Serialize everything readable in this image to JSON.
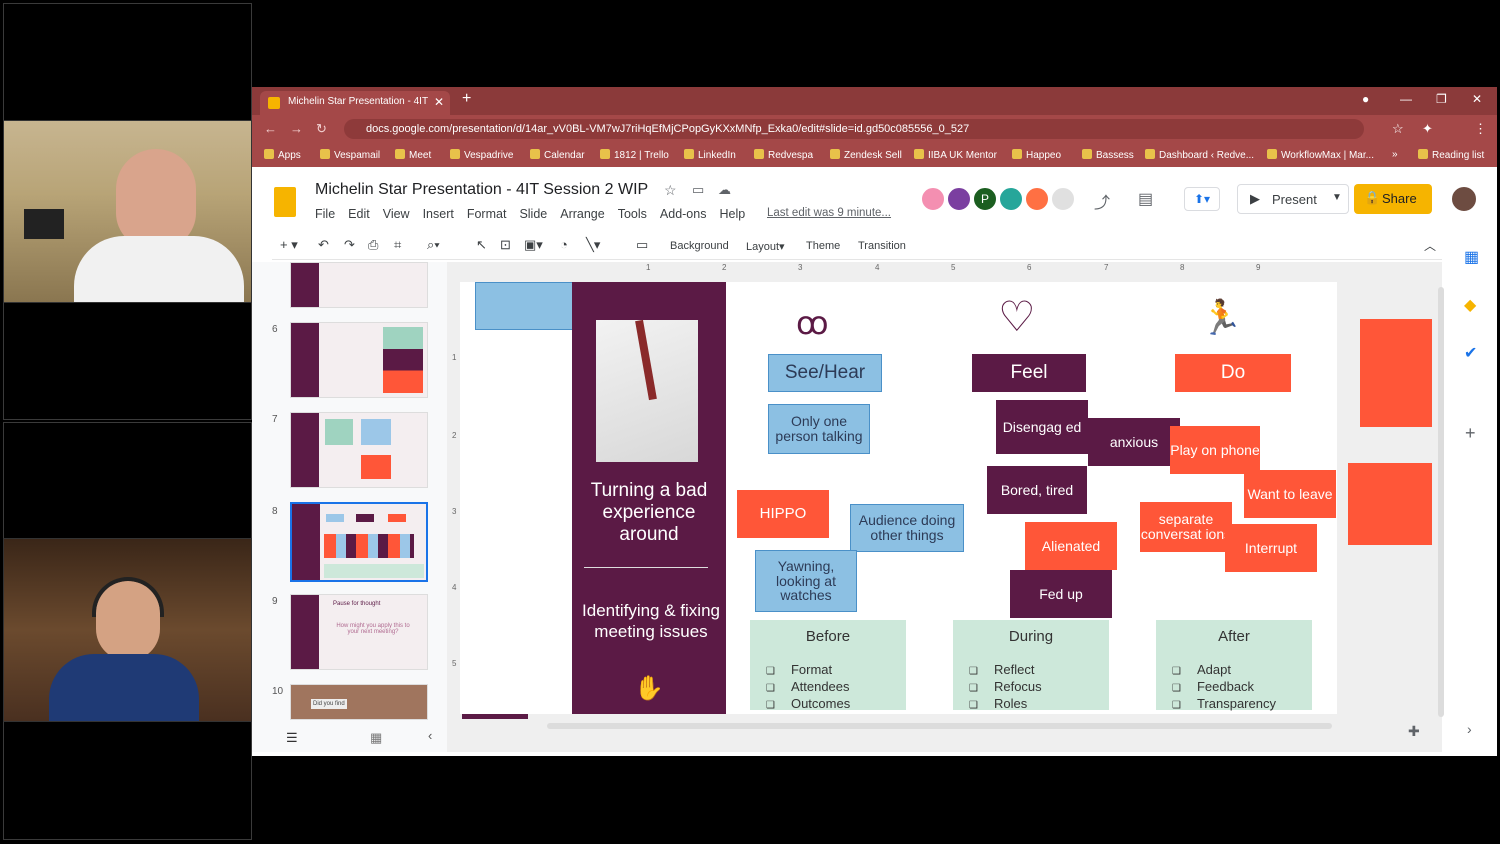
{
  "browser": {
    "tab_title": "Michelin Star Presentation - 4IT",
    "url": "docs.google.com/presentation/d/14ar_vV0BL-VM7wJ7riHqEfMjCPopGyKXxMNfp_Exka0/edit#slide=id.gd50c085556_0_527",
    "bookmarks": [
      "Apps",
      "Vespamail",
      "Meet",
      "Vespadrive",
      "Calendar",
      "1812 | Trello",
      "LinkedIn",
      "Redvespa",
      "Zendesk Sell",
      "IIBA UK Mentor",
      "Happeo",
      "Bassess",
      "Dashboard ‹ Redve...",
      "WorkflowMax | Mar...",
      "»",
      "Reading list"
    ]
  },
  "docs": {
    "title": "Michelin Star Presentation - 4IT Session 2 WIP",
    "menu": [
      "File",
      "Edit",
      "View",
      "Insert",
      "Format",
      "Slide",
      "Arrange",
      "Tools",
      "Add-ons",
      "Help"
    ],
    "last_edit": "Last edit was 9 minute...",
    "present_label": "Present",
    "share_label": "Share",
    "avatar_initial": "P"
  },
  "toolbar": {
    "background": "Background",
    "layout": "Layout",
    "theme": "Theme",
    "transition": "Transition"
  },
  "filmstrip": {
    "numbers": [
      "6",
      "7",
      "8",
      "9",
      "10"
    ],
    "thumb9_title": "Pause for thought",
    "thumb9_text": "How might you apply this to your next meeting?",
    "thumb10_text": "Did you find"
  },
  "ruler": [
    "1",
    "2",
    "3",
    "4",
    "5",
    "6",
    "7",
    "8",
    "9"
  ],
  "vruler": [
    "1",
    "2",
    "3",
    "4",
    "5"
  ],
  "slide": {
    "heading1": "Turning a bad experience around",
    "heading2": "Identifying & fixing meeting issues",
    "see_hear": "See/Hear",
    "feel": "Feel",
    "do": "Do",
    "only_one": "Only one person talking",
    "hippo": "HIPPO",
    "audience": "Audience doing other things",
    "yawning": "Yawning, looking at watches",
    "disengaged": "Disengag ed",
    "anxious": "anxious",
    "bored": "Bored, tired",
    "alienated": "Alienated",
    "fedup": "Fed up",
    "play_phone": "Play on phone",
    "want_leave": "Want to leave",
    "separate": "separate conversat ions",
    "interrupt": "Interrupt",
    "before": {
      "title": "Before",
      "items": [
        "Format",
        "Attendees",
        "Outcomes"
      ]
    },
    "during": {
      "title": "During",
      "items": [
        "Reflect",
        "Refocus",
        "Roles"
      ]
    },
    "after": {
      "title": "After",
      "items": [
        "Adapt",
        "Feedback",
        "Transparency"
      ]
    }
  },
  "colors": {
    "plum": "#5b1a45",
    "orange": "#ff5638",
    "blue": "#8cc0e3",
    "mint": "#cde8da",
    "tab": "#8b3a3a"
  }
}
